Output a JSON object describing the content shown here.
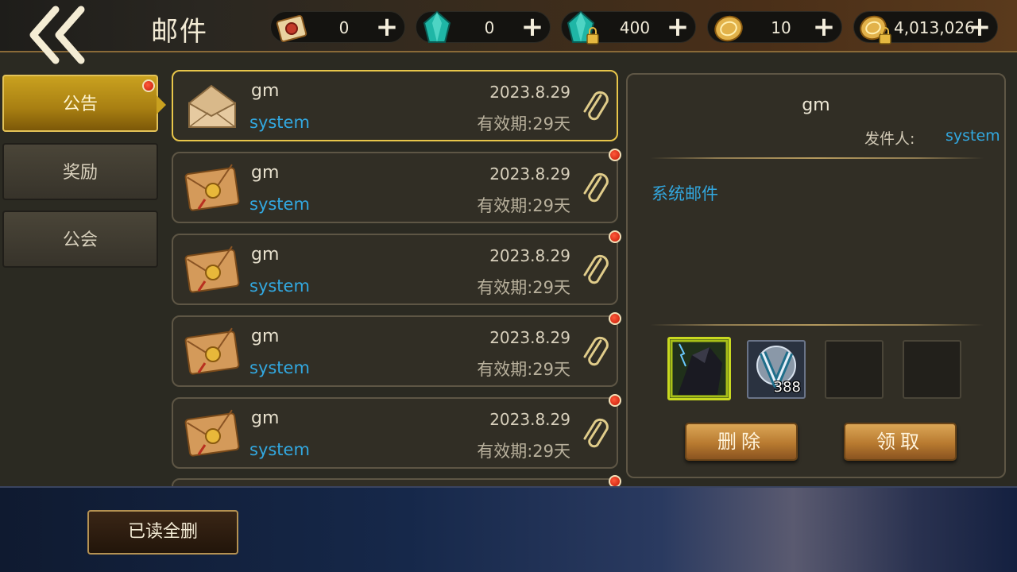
{
  "header": {
    "title": "邮件",
    "currencies": [
      {
        "icon": "scroll-icon",
        "value": "0"
      },
      {
        "icon": "diamond-icon",
        "value": "0"
      },
      {
        "icon": "locked-diamond-icon",
        "value": "400"
      },
      {
        "icon": "gold-coin-icon",
        "value": "10"
      },
      {
        "icon": "locked-gold-coin-icon",
        "value": "4,013,026"
      }
    ],
    "plus_label": "+"
  },
  "tabs": [
    {
      "label": "公告",
      "active": true,
      "unread": true
    },
    {
      "label": "奖励",
      "active": false,
      "unread": false
    },
    {
      "label": "公会",
      "active": false,
      "unread": false
    }
  ],
  "mails": [
    {
      "title": "gm",
      "sender": "system",
      "date": "2023.8.29",
      "expiry": "有效期:29天",
      "read": true,
      "selected": true
    },
    {
      "title": "gm",
      "sender": "system",
      "date": "2023.8.29",
      "expiry": "有效期:29天",
      "read": false,
      "selected": false
    },
    {
      "title": "gm",
      "sender": "system",
      "date": "2023.8.29",
      "expiry": "有效期:29天",
      "read": false,
      "selected": false
    },
    {
      "title": "gm",
      "sender": "system",
      "date": "2023.8.29",
      "expiry": "有效期:29天",
      "read": false,
      "selected": false
    },
    {
      "title": "gm",
      "sender": "system",
      "date": "2023.8.29",
      "expiry": "有效期:29天",
      "read": false,
      "selected": false
    }
  ],
  "detail": {
    "title": "gm",
    "sender_label": "发件人:",
    "sender": "system",
    "body": "系统邮件",
    "rewards": [
      {
        "icon": "hero-card-icon",
        "count": ""
      },
      {
        "icon": "vip-badge-icon",
        "count": "388"
      }
    ],
    "delete_label": "删除",
    "claim_label": "领取"
  },
  "footer": {
    "delete_read_label": "已读全删"
  },
  "colors": {
    "accent_gold": "#c9a11f",
    "link_blue": "#32a8e0",
    "unread_red": "#d42a10"
  }
}
